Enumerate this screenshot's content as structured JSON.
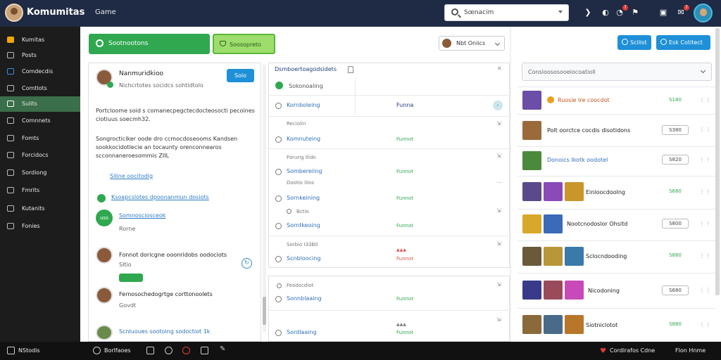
{
  "header": {
    "title": "Komumitas",
    "subtitle": "Game",
    "search_placeholder": "Sœnacim",
    "notif_badge": "7",
    "msg_badge": "7"
  },
  "sidebar": {
    "items": [
      {
        "label": "Kumitas",
        "icon": "home-icon",
        "style": "orange"
      },
      {
        "label": "Posts",
        "icon": "posts-icon",
        "style": ""
      },
      {
        "label": "Comdecdis",
        "icon": "chat-icon",
        "style": "blue"
      },
      {
        "label": "Comtlots",
        "icon": "list-icon",
        "style": ""
      },
      {
        "label": "Sulits",
        "icon": "edit-icon",
        "style": "active"
      },
      {
        "label": "Comnnets",
        "icon": "comments-icon",
        "style": ""
      },
      {
        "label": "Fomts",
        "icon": "forum-icon",
        "style": ""
      },
      {
        "label": "Forcidocs",
        "icon": "docs-icon",
        "style": ""
      },
      {
        "label": "Sordiong",
        "icon": "tools-icon",
        "style": ""
      },
      {
        "label": "Fmrits",
        "icon": "share-icon",
        "style": ""
      },
      {
        "label": "Kutanits",
        "icon": "calendar-icon",
        "style": ""
      },
      {
        "label": "Fonies",
        "icon": "settings-icon",
        "style": ""
      }
    ]
  },
  "toolbar": {
    "primary_label": "Sootnootons",
    "secondary_label": "Soosopreto",
    "select_label": "Nbt Oniics"
  },
  "profile": {
    "name": "Nanmuridkioo",
    "sub": "Nichcrtotes socidcs sohtidtolo",
    "follow_label": "Solo",
    "para1": "Portcloome soid s comanecpegctecdocteosocti pecoines ciotiuus soecmh32.",
    "para2": "Songrocticiker oode dro ccmocdoseooms Kandsen sookkocidotlecie an tocaunty orenconnearos scconnaneroesommis ZIIL",
    "link1": "Siline oocitodig",
    "link2": "Ksoapcslotes dpoonanmun dosiots",
    "group_name": "Somnosciosceok",
    "group_sub": "Rorne",
    "group_tag": "uss",
    "comments": [
      {
        "text": "Fonnot doricgne ooonridobs oodociots",
        "sub": "SItio",
        "badge": ""
      },
      {
        "text": "Fernosochedogrtge corttonoolets",
        "sub": "Govdt",
        "badge": ""
      },
      {
        "text": "Scnluoues sootoing sodoctiot 1k",
        "sub": "",
        "badge": ""
      }
    ]
  },
  "tasks": {
    "title": "Dsmboertoagodsidets",
    "sub": "Sokonoaling",
    "col_status": "Funna",
    "rows": [
      {
        "meta": "",
        "label": "Kornboleing",
        "status": "Funna"
      },
      {
        "meta": "Reciolin",
        "label": "Komnuteing",
        "status": "Funnot"
      },
      {
        "meta": "Forurig Ilido",
        "label": "Sombereiing",
        "status": "Funnot"
      },
      {
        "meta": "Dootio Iilos",
        "label": "Sornkeining",
        "status": "Funnot"
      },
      {
        "meta": "Bctio",
        "label": "Sorntkeoing",
        "status": "Funnot"
      },
      {
        "meta": "Sorbio I33B0",
        "label": "Scnbloocing",
        "status": "Funnot"
      }
    ],
    "rows2": [
      {
        "meta": "Feodocdiot",
        "label": "Sonnblaaing",
        "status": "Funnot"
      },
      {
        "meta": "",
        "label": "Sordlaaing",
        "status": "Funnot"
      }
    ]
  },
  "right": {
    "btn1": "Scilist",
    "btn2": "Esk Cotitect",
    "select": "Consloososooeiocoatioll",
    "items": [
      {
        "name": "Ruosie Ire coocdot",
        "pill": "S180",
        "green": true,
        "style": "orange"
      },
      {
        "name": "Polt oorctce cocdis disotidons",
        "pill": "S380",
        "green": false,
        "style": ""
      },
      {
        "name": "Donoics Ikotk oodotel",
        "pill": "S820",
        "green": false,
        "style": "blue"
      },
      {
        "name": "Einloocdoolng",
        "pill": "S680",
        "green": true,
        "style": ""
      },
      {
        "name": "Nootcnodoslor Ohsitd",
        "pill": "S800",
        "green": false,
        "style": ""
      },
      {
        "name": "Sclocndooding",
        "pill": "S880",
        "green": true,
        "style": ""
      },
      {
        "name": "Nicodoning",
        "pill": "S680",
        "green": false,
        "style": ""
      },
      {
        "name": "Siotniclotot",
        "pill": "S880",
        "green": true,
        "style": ""
      }
    ]
  },
  "footer": {
    "left": "NStodis",
    "mid": "Borlfaoes",
    "right1": "Cordlrafos Cdne",
    "right2": "Flon Hnme"
  }
}
